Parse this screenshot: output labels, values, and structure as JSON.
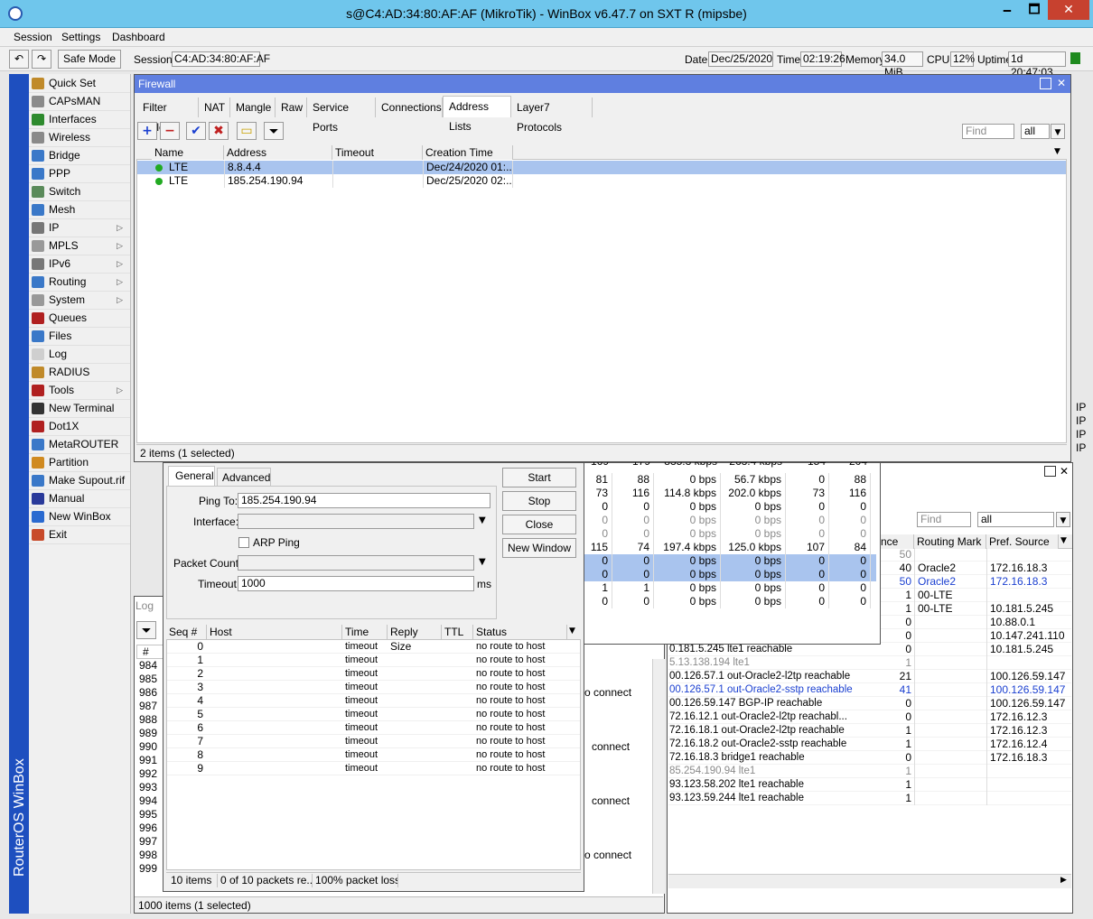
{
  "window": {
    "title": "s@C4:AD:34:80:AF:AF (MikroTik) - WinBox v6.47.7 on SXT R (mipsbe)",
    "min": "🗕",
    "max": "🗖",
    "close": "✕"
  },
  "menu": {
    "session": "Session",
    "settings": "Settings",
    "dashboard": "Dashboard"
  },
  "toolbar": {
    "undo": "↶",
    "redo": "↷",
    "safe_mode": "Safe Mode",
    "session_label": "Session:",
    "session_value": "C4:AD:34:80:AF:AF",
    "date_label": "Date:",
    "date": "Dec/25/2020",
    "time_label": "Time:",
    "time": "02:19:26",
    "memory_label": "Memory:",
    "memory": "34.0 MiB",
    "cpu_label": "CPU:",
    "cpu": "12%",
    "uptime_label": "Uptime:",
    "uptime": "1d 20:47:03"
  },
  "sidebar": {
    "brand": "RouterOS WinBox",
    "items": [
      {
        "label": "Quick Set",
        "icon": "wand-icon",
        "color": "#c08a2a",
        "sub": false
      },
      {
        "label": "CAPsMAN",
        "icon": "antenna-icon",
        "color": "#8a8a8a",
        "sub": false
      },
      {
        "label": "Interfaces",
        "icon": "interfaces-icon",
        "color": "#2e8b2e",
        "sub": false
      },
      {
        "label": "Wireless",
        "icon": "wireless-icon",
        "color": "#8a8a8a",
        "sub": false
      },
      {
        "label": "Bridge",
        "icon": "bridge-icon",
        "color": "#3a78c8",
        "sub": false
      },
      {
        "label": "PPP",
        "icon": "ppp-icon",
        "color": "#3a78c8",
        "sub": false
      },
      {
        "label": "Switch",
        "icon": "switch-icon",
        "color": "#5a8a5a",
        "sub": false
      },
      {
        "label": "Mesh",
        "icon": "mesh-icon",
        "color": "#3a78c8",
        "sub": false
      },
      {
        "label": "IP",
        "icon": "ip-icon",
        "color": "#777777",
        "sub": true
      },
      {
        "label": "MPLS",
        "icon": "mpls-icon",
        "color": "#999999",
        "sub": true
      },
      {
        "label": "IPv6",
        "icon": "ipv6-icon",
        "color": "#777777",
        "sub": true
      },
      {
        "label": "Routing",
        "icon": "routing-icon",
        "color": "#3a78c8",
        "sub": true
      },
      {
        "label": "System",
        "icon": "gear-icon",
        "color": "#999999",
        "sub": true
      },
      {
        "label": "Queues",
        "icon": "queues-icon",
        "color": "#b02020",
        "sub": false
      },
      {
        "label": "Files",
        "icon": "folder-icon",
        "color": "#3a78c8",
        "sub": false
      },
      {
        "label": "Log",
        "icon": "log-icon",
        "color": "#cfcfcf",
        "sub": false
      },
      {
        "label": "RADIUS",
        "icon": "radius-icon",
        "color": "#c08a2a",
        "sub": false
      },
      {
        "label": "Tools",
        "icon": "tools-icon",
        "color": "#b02020",
        "sub": true
      },
      {
        "label": "New Terminal",
        "icon": "terminal-icon",
        "color": "#333333",
        "sub": false
      },
      {
        "label": "Dot1X",
        "icon": "dot1x-icon",
        "color": "#b02020",
        "sub": false
      },
      {
        "label": "MetaROUTER",
        "icon": "metarouter-icon",
        "color": "#3a78c8",
        "sub": false
      },
      {
        "label": "Partition",
        "icon": "partition-icon",
        "color": "#d08a20",
        "sub": false
      },
      {
        "label": "Make Supout.rif",
        "icon": "supout-icon",
        "color": "#3a78c8",
        "sub": false
      },
      {
        "label": "Manual",
        "icon": "manual-icon",
        "color": "#2a3a9a",
        "sub": false
      },
      {
        "label": "New WinBox",
        "icon": "winbox-icon",
        "color": "#2a6ad0",
        "sub": false
      },
      {
        "label": "Exit",
        "icon": "exit-icon",
        "color": "#c84a2a",
        "sub": false
      }
    ]
  },
  "firewall": {
    "title": "Firewall",
    "tabs": [
      "Filter Rules",
      "NAT",
      "Mangle",
      "Raw",
      "Service Ports",
      "Connections",
      "Address Lists",
      "Layer7 Protocols"
    ],
    "active_tab": "Address Lists",
    "find_placeholder": "Find",
    "filter_value": "all",
    "columns": [
      "Name",
      "Address",
      "Timeout",
      "Creation Time"
    ],
    "rows": [
      {
        "name": "LTE",
        "address": "8.8.4.4",
        "timeout": "",
        "created": "Dec/24/2020 01:..."
      },
      {
        "name": "LTE",
        "address": "185.254.190.94",
        "timeout": "",
        "created": "Dec/25/2020 02:..."
      }
    ],
    "status": "2 items (1 selected)"
  },
  "ping": {
    "tabs": [
      "General",
      "Advanced"
    ],
    "ping_to_label": "Ping To:",
    "ping_to": "185.254.190.94",
    "interface_label": "Interface:",
    "interface": "",
    "arp_label": "ARP Ping",
    "packet_count_label": "Packet Count:",
    "packet_count": "",
    "timeout_label": "Timeout:",
    "timeout": "1000",
    "timeout_unit": "ms",
    "buttons": [
      "Start",
      "Stop",
      "Close",
      "New Window"
    ],
    "columns": [
      "Seq #",
      "Host",
      "Time",
      "Reply Size",
      "TTL",
      "Status"
    ],
    "rows": [
      {
        "seq": "0",
        "time": "timeout",
        "status": "no route to host"
      },
      {
        "seq": "1",
        "time": "timeout",
        "status": "no route to host"
      },
      {
        "seq": "2",
        "time": "timeout",
        "status": "no route to host"
      },
      {
        "seq": "3",
        "time": "timeout",
        "status": "no route to host"
      },
      {
        "seq": "4",
        "time": "timeout",
        "status": "no route to host"
      },
      {
        "seq": "5",
        "time": "timeout",
        "status": "no route to host"
      },
      {
        "seq": "6",
        "time": "timeout",
        "status": "no route to host"
      },
      {
        "seq": "7",
        "time": "timeout",
        "status": "no route to host"
      },
      {
        "seq": "8",
        "time": "timeout",
        "status": "no route to host"
      },
      {
        "seq": "9",
        "time": "timeout",
        "status": "no route to host"
      }
    ],
    "status": [
      "10 items",
      "0 of 10 packets re...",
      "100% packet loss"
    ]
  },
  "log": {
    "title": "Log",
    "hash": "#",
    "nums": [
      "984",
      "985",
      "986",
      "987",
      "988",
      "989",
      "990",
      "991",
      "992",
      "993",
      "994",
      "995",
      "996",
      "997",
      "998",
      "999"
    ],
    "connect": "connect",
    "connect_partial": "o connect",
    "status": "1000 items (1 selected)"
  },
  "traffic": {
    "partial_top": [
      "169",
      "179",
      "835.3 kbps",
      "263.4 kbps",
      "154",
      "204"
    ],
    "rows": [
      [
        "81",
        "88",
        "0 bps",
        "56.7 kbps",
        "0",
        "88"
      ],
      [
        "73",
        "116",
        "114.8 kbps",
        "202.0 kbps",
        "73",
        "116"
      ],
      [
        "0",
        "0",
        "0 bps",
        "0 bps",
        "0",
        "0"
      ],
      [
        "0",
        "0",
        "0 bps",
        "0 bps",
        "0",
        "0"
      ],
      [
        "0",
        "0",
        "0 bps",
        "0 bps",
        "0",
        "0"
      ],
      [
        "115",
        "74",
        "197.4 kbps",
        "125.0 kbps",
        "107",
        "84"
      ],
      [
        "0",
        "0",
        "0 bps",
        "0 bps",
        "0",
        "0"
      ],
      [
        "0",
        "0",
        "0 bps",
        "0 bps",
        "0",
        "0"
      ],
      [
        "1",
        "1",
        "0 bps",
        "0 bps",
        "0",
        "0"
      ],
      [
        "0",
        "0",
        "0 bps",
        "0 bps",
        "0",
        "0"
      ]
    ]
  },
  "routes": {
    "find_placeholder": "Find",
    "filter_value": "all",
    "columns": [
      "nce",
      "Routing Mark",
      "Pref. Source"
    ],
    "rows": [
      {
        "gw": "",
        "dist": "50",
        "mark": "",
        "src": "",
        "style": "grey"
      },
      {
        "gw": "",
        "dist": "40",
        "mark": "Oracle2",
        "src": "172.16.18.3",
        "style": ""
      },
      {
        "gw": "",
        "dist": "50",
        "mark": "Oracle2",
        "src": "172.16.18.3",
        "style": "blue"
      },
      {
        "gw": "",
        "dist": "1",
        "mark": "00-LTE",
        "src": "",
        "style": ""
      },
      {
        "gw": "",
        "dist": "1",
        "mark": "00-LTE",
        "src": "10.181.5.245",
        "style": ""
      },
      {
        "gw": "",
        "dist": "0",
        "mark": "",
        "src": "10.88.0.1",
        "style": ""
      },
      {
        "gw": "",
        "dist": "0",
        "mark": "",
        "src": "10.147.241.110",
        "style": ""
      },
      {
        "gw": "0.181.5.245 lte1 reachable",
        "dist": "0",
        "mark": "",
        "src": "10.181.5.245",
        "style": ""
      },
      {
        "gw": "5.13.138.194 lte1",
        "dist": "1",
        "mark": "",
        "src": "",
        "style": "grey"
      },
      {
        "gw": "00.126.57.1 out-Oracle2-l2tp reachable",
        "dist": "21",
        "mark": "",
        "src": "100.126.59.147",
        "style": ""
      },
      {
        "gw": "00.126.57.1 out-Oracle2-sstp reachable",
        "dist": "41",
        "mark": "",
        "src": "100.126.59.147",
        "style": "blue"
      },
      {
        "gw": "00.126.59.147 BGP-IP reachable",
        "dist": "0",
        "mark": "",
        "src": "100.126.59.147",
        "style": ""
      },
      {
        "gw": "72.16.12.1 out-Oracle2-l2tp reachabl...",
        "dist": "0",
        "mark": "",
        "src": "172.16.12.3",
        "style": ""
      },
      {
        "gw": "72.16.18.1 out-Oracle2-l2tp reachable",
        "dist": "1",
        "mark": "",
        "src": "172.16.12.3",
        "style": ""
      },
      {
        "gw": "72.16.18.2 out-Oracle2-sstp reachable",
        "dist": "1",
        "mark": "",
        "src": "172.16.12.4",
        "style": ""
      },
      {
        "gw": "72.16.18.3 bridge1 reachable",
        "dist": "0",
        "mark": "",
        "src": "172.16.18.3",
        "style": ""
      },
      {
        "gw": "85.254.190.94 lte1",
        "dist": "1",
        "mark": "",
        "src": "",
        "style": "grey"
      },
      {
        "gw": "93.123.58.202 lte1 reachable",
        "dist": "1",
        "mark": "",
        "src": "",
        "style": ""
      },
      {
        "gw": "93.123.59.244 lte1 reachable",
        "dist": "1",
        "mark": "",
        "src": "",
        "style": ""
      }
    ],
    "ip_labels": [
      "IP",
      "IP",
      "IP",
      "IP"
    ]
  }
}
